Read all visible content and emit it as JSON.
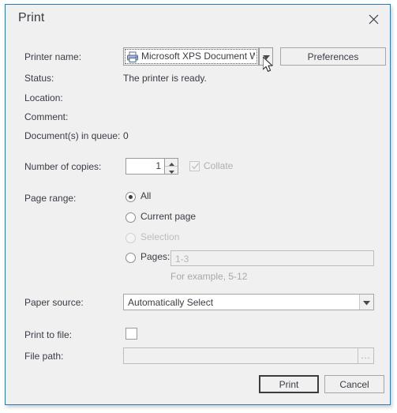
{
  "dialog": {
    "title": "Print",
    "close_icon": "close-icon",
    "accent_border": "#2a7ab8",
    "background": "#f0f0f0"
  },
  "printer": {
    "label": "Printer name:",
    "icon": "printer-icon",
    "selected": "Microsoft XPS Document Wr...",
    "dropdown_icon": "chevron-down-icon",
    "preferences_label": "Preferences"
  },
  "info": {
    "status_label": "Status:",
    "status_value": "The printer is ready.",
    "location_label": "Location:",
    "location_value": "",
    "comment_label": "Comment:",
    "comment_value": "",
    "queue_label": "Document(s) in queue:",
    "queue_value": "0"
  },
  "copies": {
    "label": "Number of copies:",
    "value": "1",
    "spin_up_icon": "spinner-up-icon",
    "spin_down_icon": "spinner-down-icon",
    "collate_label": "Collate",
    "collate_checked": true,
    "collate_enabled": false,
    "collate_icon": "checkmark-icon"
  },
  "page_range": {
    "label": "Page range:",
    "options": [
      {
        "label": "All",
        "selected": true,
        "enabled": true
      },
      {
        "label": "Current page",
        "selected": false,
        "enabled": true
      },
      {
        "label": "Selection",
        "selected": false,
        "enabled": false
      },
      {
        "label": "Pages:",
        "selected": false,
        "enabled": true
      }
    ],
    "pages_value": "",
    "pages_placeholder": "1-3",
    "pages_hint": "For example, 5-12"
  },
  "paper_source": {
    "label": "Paper source:",
    "selected": "Automatically Select",
    "dropdown_icon": "chevron-down-icon"
  },
  "print_to_file": {
    "label": "Print to file:",
    "checked": false
  },
  "file_path": {
    "label": "File path:",
    "value": "",
    "browse_label": "...",
    "enabled": false
  },
  "footer": {
    "print_label": "Print",
    "cancel_label": "Cancel"
  },
  "cursor": {
    "icon": "mouse-pointer-icon"
  }
}
